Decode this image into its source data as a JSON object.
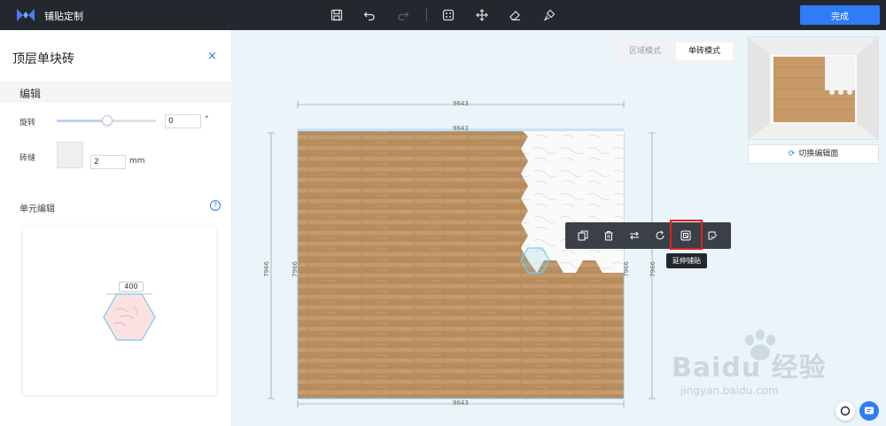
{
  "app": {
    "title": "铺贴定制",
    "done_label": "完成"
  },
  "toolbar": {
    "icons": [
      "save-icon",
      "undo-icon",
      "redo-icon",
      "fit-icon",
      "move-icon",
      "eraser-icon",
      "brush-icon"
    ]
  },
  "panel": {
    "title": "顶层单块砖",
    "close": "×",
    "section_edit": "编辑",
    "rotation_label": "旋转",
    "rotation_value": "0",
    "rotation_unit": "°",
    "grout_label": "砖缝",
    "grout_value": "2",
    "grout_unit": "mm",
    "unit_edit_label": "单元编辑",
    "help": "?",
    "unit_dimension": "400"
  },
  "modes": {
    "area": "区域模式",
    "single": "单砖模式"
  },
  "preview": {
    "switch_label": "切换编辑面",
    "switch_icon": "refresh-icon"
  },
  "canvas": {
    "width_top_outer": "9643",
    "width_top_inner": "9643",
    "width_bottom": "9643",
    "height_left_outer": "7966",
    "height_left_inner": "7966",
    "height_right_inner": "7966",
    "height_right_outer": "7966"
  },
  "float_toolbar": {
    "icons": [
      "copy-icon",
      "delete-icon",
      "swap-icon",
      "rotate-icon",
      "extend-tile-icon",
      "edit-check-icon"
    ],
    "tooltip": "延伸铺贴"
  },
  "watermark": {
    "brand": "Baidu 经验",
    "url": "jingyan.baidu.com"
  },
  "colors": {
    "accent": "#2f7cf6",
    "topbar": "#23272e",
    "wood": "#c49a6c",
    "highlight": "#e02020"
  }
}
